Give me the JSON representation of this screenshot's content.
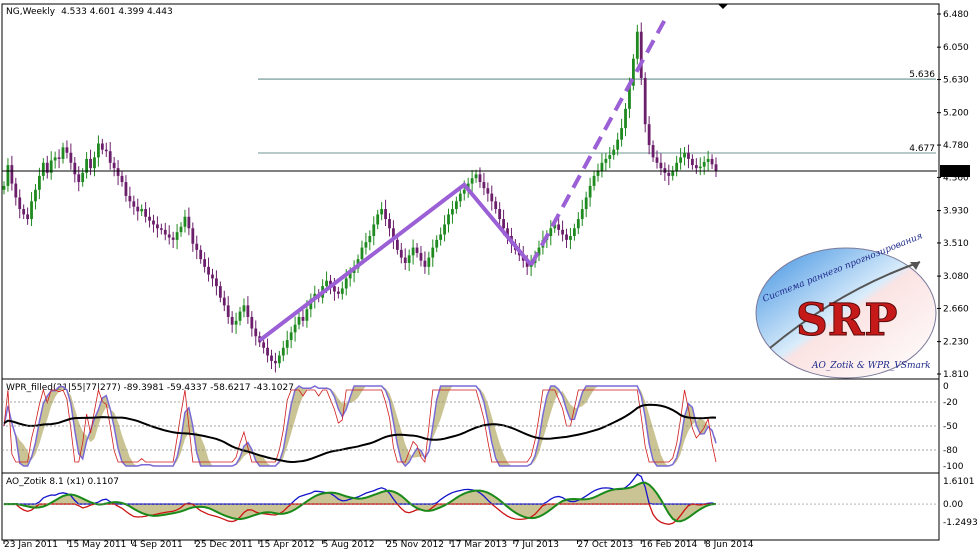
{
  "header": {
    "title": "NG,Weekly",
    "ohlc": "4.533 4.601 4.399 4.443"
  },
  "colors": {
    "bull_candle": "#1f8a1f",
    "bear_candle": "#6b1f6b",
    "pattern_line": "#9b5fd6",
    "fib_line": "#3f6f6f",
    "current_line": "#000000",
    "wpr_fast": "#d11a1a",
    "wpr_slow": "#000000",
    "ao_blue": "#1414cc",
    "ao_red": "#cc1414",
    "ao_green": "#1a8a1a"
  },
  "price_axis": {
    "ticks": [
      "6.480",
      "6.050",
      "5.630",
      "5.200",
      "4.780",
      "4.360",
      "3.930",
      "3.510",
      "3.080",
      "2.660",
      "2.230",
      "1.810"
    ],
    "fib_labels": [
      "5.636",
      "4.677"
    ],
    "current_price": "4.443"
  },
  "wpr_panel": {
    "title": "WPR_filled(21|55|77|277) -89.3981 -59.4337 -58.6217 -43.1027",
    "ticks": [
      "0",
      "-20",
      "-50",
      "-80",
      "-100"
    ]
  },
  "ao_panel": {
    "title": "AO_Zotik 8.1 (x1) 0.1107",
    "ticks": [
      "1.6101",
      "0.00",
      "-1.2493"
    ]
  },
  "time_axis": {
    "labels": [
      "23 Jan 2011",
      "15 May 2011",
      "4 Sep 2011",
      "25 Dec 2011",
      "15 Apr 2012",
      "5 Aug 2012",
      "25 Nov 2012",
      "17 Mar 2013",
      "7 Jul 2013",
      "27 Oct 2013",
      "16 Feb 2014",
      "8 Jun 2014"
    ]
  },
  "logo": {
    "text": "SRP",
    "top_text": "Система раннего прогнозирования",
    "bottom_text": "AO_Zotik & WPR_VSmark"
  },
  "chart_data": {
    "type": "candlestick",
    "title": "NG,Weekly",
    "ylim": [
      1.81,
      6.48
    ],
    "fib_levels": [
      5.636,
      4.677
    ],
    "current_price": 4.443,
    "closes": [
      4.25,
      4.52,
      4.28,
      4.1,
      3.95,
      3.88,
      3.82,
      4.05,
      4.2,
      4.38,
      4.55,
      4.42,
      4.58,
      4.62,
      4.6,
      4.75,
      4.68,
      4.55,
      4.4,
      4.3,
      4.42,
      4.6,
      4.48,
      4.62,
      4.8,
      4.72,
      4.7,
      4.55,
      4.48,
      4.38,
      4.3,
      4.12,
      4.05,
      3.98,
      3.92,
      3.95,
      3.85,
      3.8,
      3.75,
      3.7,
      3.68,
      3.62,
      3.58,
      3.55,
      3.65,
      3.72,
      3.85,
      3.7,
      3.5,
      3.42,
      3.3,
      3.2,
      3.1,
      3.05,
      2.95,
      2.8,
      2.7,
      2.55,
      2.45,
      2.5,
      2.62,
      2.7,
      2.55,
      2.4,
      2.3,
      2.22,
      2.15,
      2.05,
      1.98,
      1.95,
      2.05,
      2.15,
      2.25,
      2.35,
      2.45,
      2.55,
      2.5,
      2.65,
      2.78,
      2.85,
      2.8,
      2.95,
      3.02,
      2.95,
      2.88,
      2.85,
      2.92,
      3.05,
      3.12,
      3.18,
      3.3,
      3.45,
      3.52,
      3.6,
      3.75,
      3.88,
      3.95,
      3.82,
      3.7,
      3.55,
      3.42,
      3.32,
      3.25,
      3.35,
      3.45,
      3.38,
      3.28,
      3.2,
      3.32,
      3.45,
      3.55,
      3.62,
      3.75,
      3.88,
      3.95,
      4.05,
      4.15,
      4.2,
      4.28,
      4.35,
      4.4,
      4.3,
      4.22,
      4.15,
      4.05,
      3.95,
      3.82,
      3.7,
      3.6,
      3.5,
      3.42,
      3.35,
      3.28,
      3.2,
      3.25,
      3.35,
      3.45,
      3.55,
      3.6,
      3.7,
      3.75,
      3.68,
      3.62,
      3.55,
      3.6,
      3.7,
      3.82,
      3.95,
      4.1,
      4.25,
      4.38,
      4.45,
      4.55,
      4.6,
      4.65,
      4.72,
      4.85,
      5.0,
      5.25,
      5.55,
      5.9,
      6.25,
      5.65,
      5.05,
      4.78,
      4.62,
      4.55,
      4.48,
      4.42,
      4.38,
      4.45,
      4.55,
      4.62,
      4.68,
      4.6,
      4.52,
      4.48,
      4.5,
      4.56,
      4.6,
      4.53,
      4.44
    ]
  }
}
